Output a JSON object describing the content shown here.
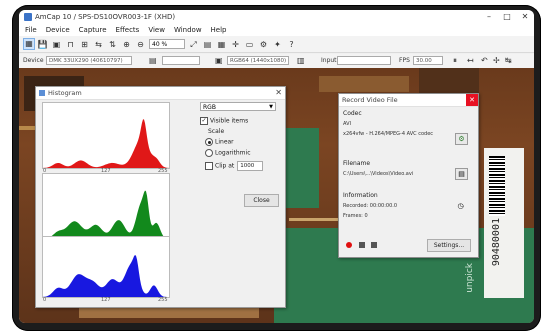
{
  "window": {
    "title": "AmCap 10 / SPS-DS10OVR003-1F (XHD)",
    "controls": [
      "–",
      "□",
      "✕"
    ]
  },
  "menu": [
    "File",
    "Device",
    "Capture",
    "Effects",
    "View",
    "Window",
    "Help"
  ],
  "toolbar": {
    "zoom_value": "40 %"
  },
  "device_bar": {
    "device_label": "Device",
    "device_value": "DMK 33UX290 (40610797)",
    "format_value": "RGB64 (1440x1080)",
    "input_label": "Input",
    "fps_label": "FPS",
    "fps_value": "30.00"
  },
  "histogram": {
    "title": "Histogram",
    "channel": "RGB",
    "visible_items_label": "Visible items",
    "scale_label": "Scale",
    "linear_label": "Linear",
    "logarithmic_label": "Logarithmic",
    "clip_label": "Clip at",
    "clip_value": "1000",
    "close_label": "Close",
    "ticks": [
      "0",
      "127",
      "255"
    ],
    "colors": {
      "red": "#e01818",
      "green": "#12891c",
      "blue": "#1818e0"
    }
  },
  "record": {
    "title": "Record Video File",
    "close_glyph": "✕",
    "codec_header": "Codec",
    "avi_label": "AVI",
    "codec_value": "x264vfw - H.264/MPEG-4 AVC codec",
    "filename_header": "Filename",
    "filename_value": "C:\\Users\\...\\Videos\\Video.avi",
    "info_header": "Information",
    "recorded_value": "Recorded: 00:00:00.0",
    "frames_value": "Frames: 0",
    "settings_label": "Settings..."
  },
  "pcb_label": {
    "text": "90480001",
    "side_text": "unpick"
  }
}
